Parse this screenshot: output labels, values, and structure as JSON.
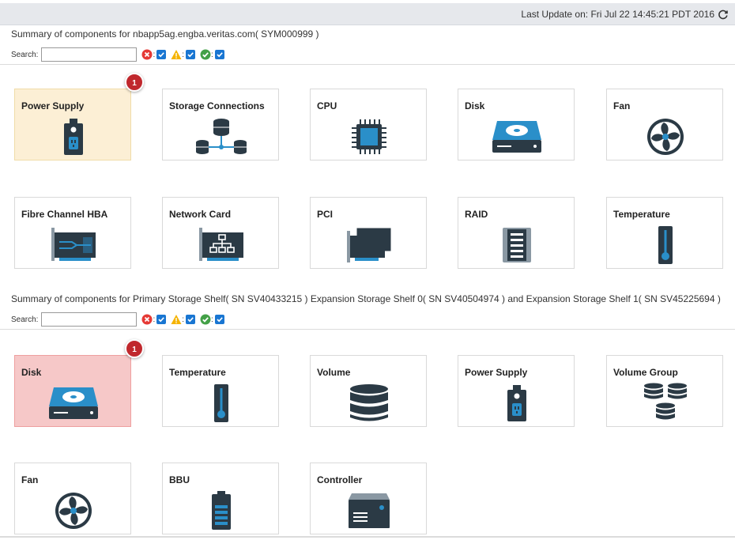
{
  "header": {
    "last_update": "Last Update on: Fri Jul 22 14:45:21 PDT 2016",
    "refresh_icon": "refresh-icon"
  },
  "sections": [
    {
      "title": "Summary of components for nbapp5ag.engba.veritas.com( SYM000999 )",
      "search_label": "Search:",
      "search_value": "",
      "filters": [
        {
          "icon": "error-icon",
          "color": "#e53935",
          "checked": true
        },
        {
          "icon": "warning-icon",
          "color": "#f5b300",
          "checked": true
        },
        {
          "icon": "ok-icon",
          "color": "#43a047",
          "checked": true
        }
      ],
      "components": [
        {
          "label": "Power Supply",
          "icon": "power-supply-icon",
          "status": "warning",
          "badge": "1"
        },
        {
          "label": "Storage Connections",
          "icon": "storage-connections-icon",
          "status": "ok",
          "badge": ""
        },
        {
          "label": "CPU",
          "icon": "cpu-icon",
          "status": "ok",
          "badge": ""
        },
        {
          "label": "Disk",
          "icon": "disk-icon",
          "status": "ok",
          "badge": ""
        },
        {
          "label": "Fan",
          "icon": "fan-icon",
          "status": "ok",
          "badge": ""
        },
        {
          "label": "Fibre Channel HBA",
          "icon": "fibre-channel-hba-icon",
          "status": "ok",
          "badge": ""
        },
        {
          "label": "Network Card",
          "icon": "network-card-icon",
          "status": "ok",
          "badge": ""
        },
        {
          "label": "PCI",
          "icon": "pci-icon",
          "status": "ok",
          "badge": ""
        },
        {
          "label": "RAID",
          "icon": "raid-icon",
          "status": "ok",
          "badge": ""
        },
        {
          "label": "Temperature",
          "icon": "temperature-icon",
          "status": "ok",
          "badge": ""
        }
      ]
    },
    {
      "title": "Summary of components for Primary Storage Shelf( SN SV40433215 ) Expansion Storage Shelf 0( SN SV40504974 ) and Expansion Storage Shelf 1( SN SV45225694 )",
      "search_label": "Search:",
      "search_value": "",
      "filters": [
        {
          "icon": "error-icon",
          "color": "#e53935",
          "checked": true
        },
        {
          "icon": "warning-icon",
          "color": "#f5b300",
          "checked": true
        },
        {
          "icon": "ok-icon",
          "color": "#43a047",
          "checked": true
        }
      ],
      "components": [
        {
          "label": "Disk",
          "icon": "disk-icon",
          "status": "critical",
          "badge": "1"
        },
        {
          "label": "Temperature",
          "icon": "temperature-icon",
          "status": "ok",
          "badge": ""
        },
        {
          "label": "Volume",
          "icon": "volume-icon",
          "status": "ok",
          "badge": ""
        },
        {
          "label": "Power Supply",
          "icon": "power-supply-icon",
          "status": "ok",
          "badge": ""
        },
        {
          "label": "Volume Group",
          "icon": "volume-group-icon",
          "status": "ok",
          "badge": ""
        },
        {
          "label": "Fan",
          "icon": "fan-icon",
          "status": "ok",
          "badge": ""
        },
        {
          "label": "BBU",
          "icon": "bbu-icon",
          "status": "ok",
          "badge": ""
        },
        {
          "label": "Controller",
          "icon": "controller-icon",
          "status": "ok",
          "badge": ""
        }
      ]
    }
  ],
  "colors": {
    "icon_dark": "#2b3a45",
    "icon_accent": "#2a8fc9",
    "warning_bg": "#fcefd5",
    "critical_bg": "#f6c8c8",
    "badge": "#c0282d",
    "checkbox": "#1976d2"
  }
}
